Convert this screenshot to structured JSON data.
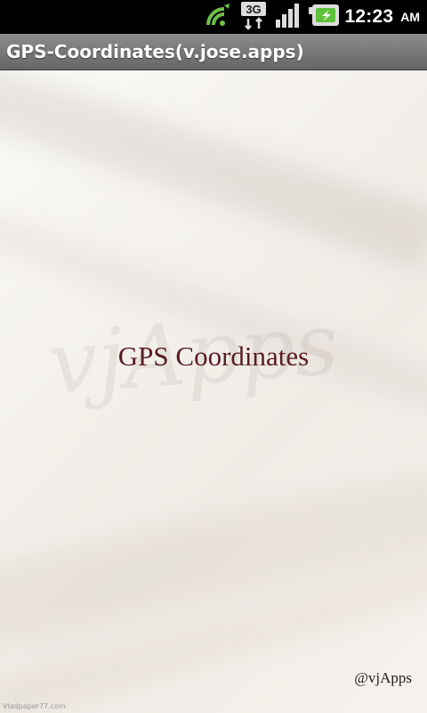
{
  "status_bar": {
    "time": "12:23",
    "ampm": "AM",
    "network": "3G",
    "icons": [
      "sync-icon",
      "network-3g-icon",
      "signal-icon",
      "battery-charging-icon"
    ]
  },
  "title_bar": {
    "title": "GPS-Coordinates(v.jose.apps)"
  },
  "splash": {
    "app_name": "GPS Coordinates",
    "brand": "@vjApps",
    "credit": "Vladpaper77.com"
  }
}
